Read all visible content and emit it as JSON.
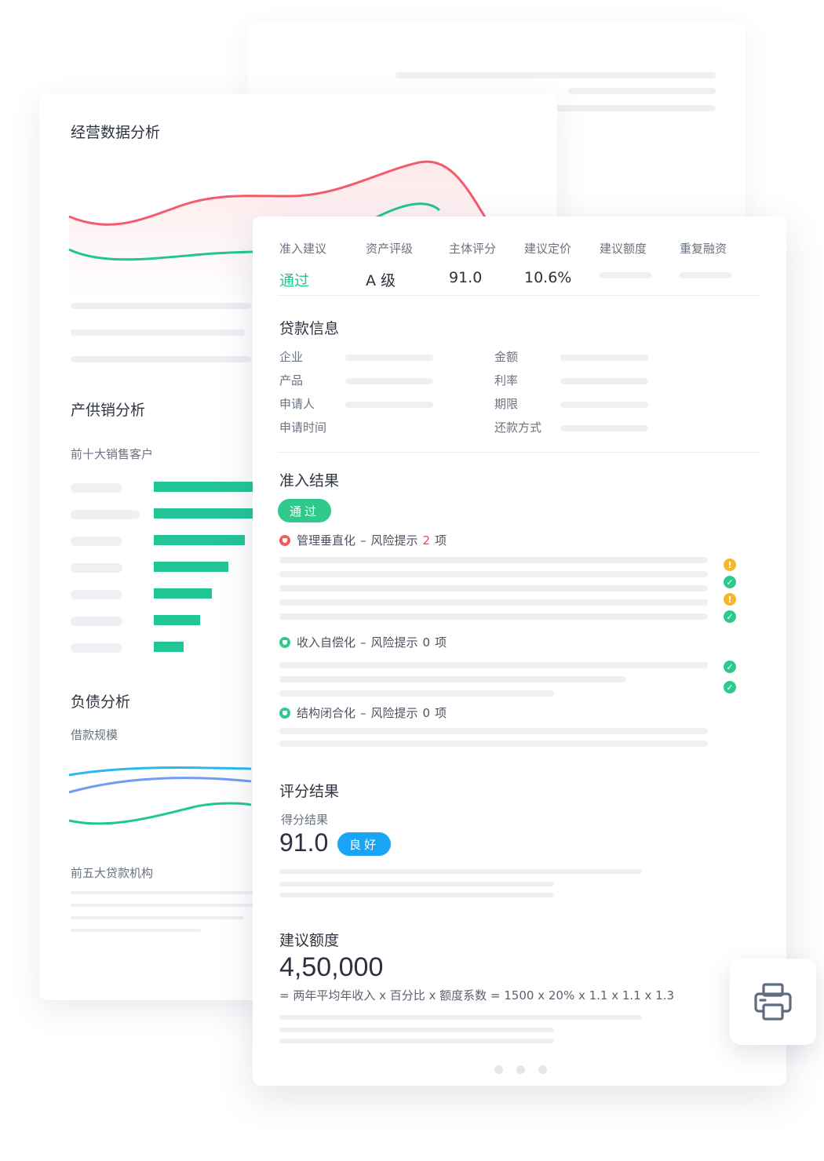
{
  "left_panel": {
    "title_ops": "经营数据分析",
    "title_supply": "产供销分析",
    "sub_top_customers": "前十大销售客户",
    "title_debt": "负债分析",
    "sub_loan_scale": "借款规模",
    "sub_top_lenders": "前五大贷款机构",
    "top_customers_bars": [
      0.7,
      0.62,
      0.55,
      0.45,
      0.35,
      0.28,
      0.18
    ]
  },
  "summary": {
    "admission_label": "准入建议",
    "admission_value": "通过",
    "rating_label": "资产评级",
    "rating_value": "A 级",
    "score_label": "主体评分",
    "score_value": "91.0",
    "pricing_label": "建议定价",
    "pricing_value": "10.6%",
    "limit_label": "建议额度",
    "refinance_label": "重复融资"
  },
  "loan_info": {
    "title": "贷款信息",
    "fields_left": [
      "企业",
      "产品",
      "申请人",
      "申请时间"
    ],
    "fields_right": [
      "金额",
      "利率",
      "期限",
      "还款方式"
    ]
  },
  "admission_result": {
    "title": "准入结果",
    "badge": "通过",
    "groups": [
      {
        "name": "管理垂直化",
        "sep": "–",
        "hint": "风险提示",
        "count": "2",
        "unit": "项"
      },
      {
        "name": "收入自偿化",
        "sep": "–",
        "hint": "风险提示",
        "count": "0",
        "unit": "项"
      },
      {
        "name": "结构闭合化",
        "sep": "–",
        "hint": "风险提示",
        "count": "0",
        "unit": "项"
      }
    ],
    "status_icons": [
      "warning-icon",
      "check-icon",
      "warning-icon",
      "check-icon",
      "check-icon",
      "check-icon"
    ],
    "colors": {
      "warning": "#f7b52c",
      "ok": "#2fc98c",
      "risk": "#f25c5c"
    }
  },
  "score_result": {
    "title": "评分结果",
    "label": "得分结果",
    "value": "91.0",
    "badge": "良好"
  },
  "suggested_limit": {
    "title": "建议额度",
    "value": "4,50,000",
    "formula": "= 两年平均年收入 x 百分比 x 额度系数 = 1500 x 20% x 1.1 x 1.1 x 1.3"
  },
  "pagination": {
    "pages": 3
  },
  "print_icon": "printer-icon"
}
